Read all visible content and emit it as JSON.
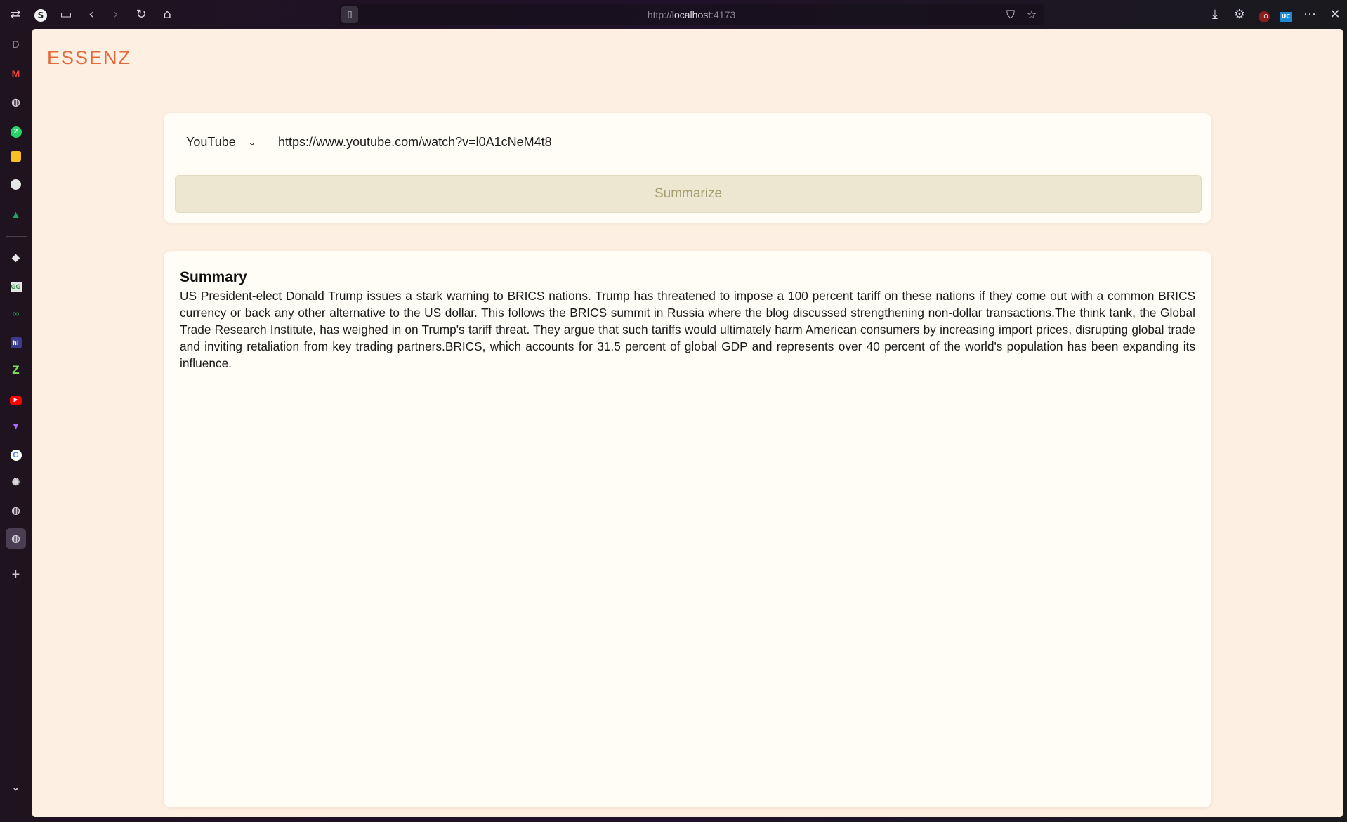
{
  "browser": {
    "url_scheme": "http://",
    "url_host": "localhost",
    "url_port": ":4173",
    "profile_letter": "S"
  },
  "sidebar": {
    "top_letter": "D",
    "items": [
      {
        "name": "gmail",
        "glyph": "M",
        "color": "#ea4335"
      },
      {
        "name": "globe",
        "glyph": "🌐",
        "color": "#cfc8d4"
      },
      {
        "name": "whatsapp",
        "glyph": "2",
        "color": "#25d366"
      },
      {
        "name": "keep",
        "glyph": "▪",
        "color": "#f6bf26"
      },
      {
        "name": "github",
        "glyph": "●",
        "color": "#e6e6e6"
      },
      {
        "name": "drive",
        "glyph": "▲",
        "color": "#1fa463"
      },
      {
        "name": "cube",
        "glyph": "◆",
        "color": "#e6e6e6"
      },
      {
        "name": "geeks",
        "glyph": "G",
        "color": "#2f8d46"
      },
      {
        "name": "geeks2",
        "glyph": "∞",
        "color": "#2f8d46"
      },
      {
        "name": "hashnode",
        "glyph": "h!",
        "color": "#ffffff"
      },
      {
        "name": "z-app",
        "glyph": "Z",
        "color": "#78e05a"
      },
      {
        "name": "youtube",
        "glyph": "▶",
        "color": "#ff0000"
      },
      {
        "name": "vite",
        "glyph": "▼",
        "color": "#a86bff"
      },
      {
        "name": "google",
        "glyph": "G",
        "color": "#4285f4"
      },
      {
        "name": "openai",
        "glyph": "✺",
        "color": "#d8d8d8"
      },
      {
        "name": "globe2",
        "glyph": "🌐",
        "color": "#cfc8d4"
      },
      {
        "name": "globe3-active",
        "glyph": "🌐",
        "color": "#cfc8d4"
      }
    ]
  },
  "app": {
    "logo": "ESSENZ",
    "source_select": "YouTube",
    "url_value": "https://www.youtube.com/watch?v=l0A1cNeM4t8",
    "summarize_label": "Summarize",
    "summary_title": "Summary",
    "summary_text": "US President-elect Donald Trump issues a stark warning to BRICS nations. Trump has threatened to impose a 100 percent tariff on these nations if they come out with a common BRICS currency or back any other alternative to the US dollar. This follows the BRICS summit in Russia where the blog discussed strengthening non-dollar transactions.The think tank, the Global Trade Research Institute, has weighed in on Trump's tariff threat. They argue that such tariffs would ultimately harm American consumers by increasing import prices, disrupting global trade and inviting retaliation from key trading partners.BRICS, which accounts for 31.5 percent of global GDP and represents over 40 percent of the world's population has been expanding its influence."
  },
  "colors": {
    "accent": "#e6683a",
    "page_bg": "#fdefe1",
    "card_bg": "#fffdf6",
    "button_bg": "#ede6d1",
    "button_text": "#a59c6f"
  }
}
